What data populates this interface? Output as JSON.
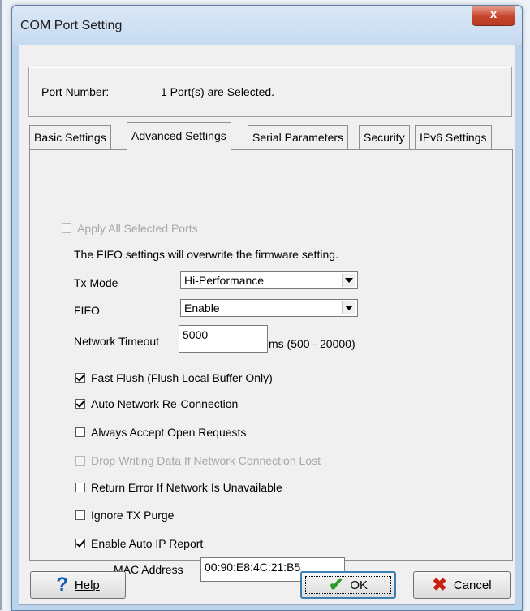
{
  "window": {
    "title": "COM Port Setting",
    "close_glyph": "x"
  },
  "port": {
    "label": "Port Number:",
    "value": "1 Port(s) are Selected."
  },
  "tabs": [
    {
      "label": "Basic Settings",
      "active": false
    },
    {
      "label": "Advanced Settings",
      "active": true
    },
    {
      "label": "Serial Parameters",
      "active": false
    },
    {
      "label": "Security",
      "active": false
    },
    {
      "label": "IPv6 Settings",
      "active": false
    }
  ],
  "advanced": {
    "apply_all": {
      "label": "Apply All Selected Ports",
      "checked": false,
      "enabled": false
    },
    "fifo_note": "The FIFO settings will overwrite the firmware setting.",
    "tx_mode": {
      "label": "Tx Mode",
      "value": "Hi-Performance"
    },
    "fifo": {
      "label": "FIFO",
      "value": "Enable"
    },
    "network_timeout": {
      "label": "Network Timeout",
      "value": "5000",
      "range": "ms (500 - 20000)"
    },
    "options": [
      {
        "label": "Fast Flush (Flush Local Buffer Only)",
        "checked": true,
        "enabled": true
      },
      {
        "label": "Auto Network Re-Connection",
        "checked": true,
        "enabled": true
      },
      {
        "label": "Always Accept Open Requests",
        "checked": false,
        "enabled": true
      },
      {
        "label": "Drop Writing Data If Network Connection Lost",
        "checked": false,
        "enabled": false
      },
      {
        "label": "Return Error If Network Is Unavailable",
        "checked": false,
        "enabled": true
      },
      {
        "label": "Ignore TX Purge",
        "checked": false,
        "enabled": true
      },
      {
        "label": "Enable Auto IP Report",
        "checked": true,
        "enabled": true
      }
    ],
    "mac_address": {
      "label": "MAC Address",
      "value": "00:90:E8:4C:21:B5"
    }
  },
  "buttons": {
    "help": {
      "label": "Help",
      "icon": "help-icon"
    },
    "ok": {
      "label": "OK",
      "icon": "checkmark-icon"
    },
    "cancel": {
      "label": "Cancel",
      "icon": "cancel-x-icon"
    }
  }
}
